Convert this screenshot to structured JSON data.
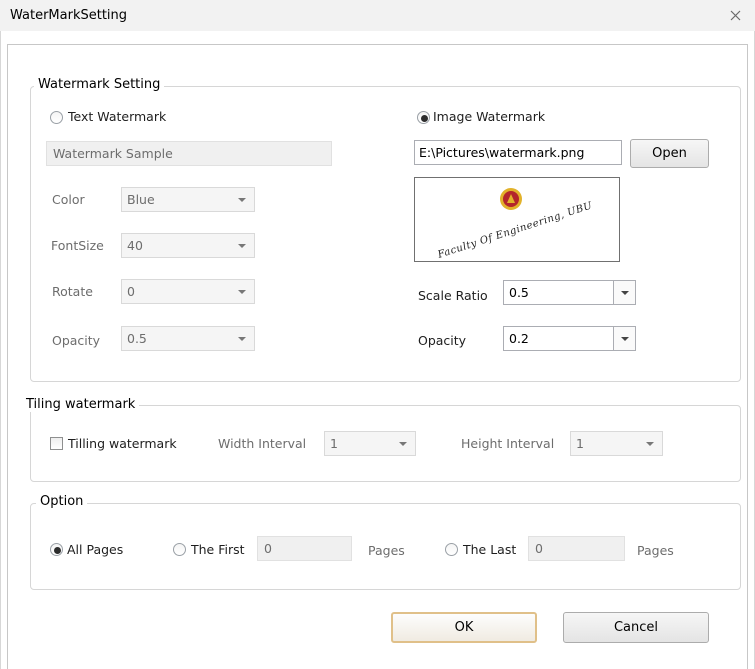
{
  "window": {
    "title": "WaterMarkSetting"
  },
  "watermark_setting": {
    "group_title": "Watermark Setting",
    "text_watermark": {
      "radio_label": "Text Watermark",
      "checked": false,
      "sample_text": "Watermark Sample",
      "color_label": "Color",
      "color_value": "Blue",
      "fontsize_label": "FontSize",
      "fontsize_value": "40",
      "rotate_label": "Rotate",
      "rotate_value": "0",
      "opacity_label": "Opacity",
      "opacity_value": "0.5"
    },
    "image_watermark": {
      "radio_label": "Image Watermark",
      "checked": true,
      "file_path": "E:\\Pictures\\watermark.png",
      "open_button": "Open",
      "preview_text": "Faculty Of Engineering, UBU",
      "scale_ratio_label": "Scale Ratio",
      "scale_ratio_value": "0.5",
      "opacity_label": "Opacity",
      "opacity_value": "0.2"
    }
  },
  "tiling": {
    "group_title": "Tiling watermark",
    "checkbox_label": "Tilling watermark",
    "checked": false,
    "width_interval_label": "Width Interval",
    "width_interval_value": "1",
    "height_interval_label": "Height Interval",
    "height_interval_value": "1"
  },
  "option": {
    "group_title": "Option",
    "all_pages_label": "All Pages",
    "the_first_label": "The First",
    "the_first_value": "0",
    "pages_label_1": "Pages",
    "the_last_label": "The Last",
    "the_last_value": "0",
    "pages_label_2": "Pages"
  },
  "buttons": {
    "ok": "OK",
    "cancel": "Cancel"
  },
  "colors": {
    "logo_red": "#b3262b",
    "logo_gold": "#e2b22a"
  },
  "icons": {
    "close": "close-icon",
    "dropdown": "chevron-down-icon"
  }
}
